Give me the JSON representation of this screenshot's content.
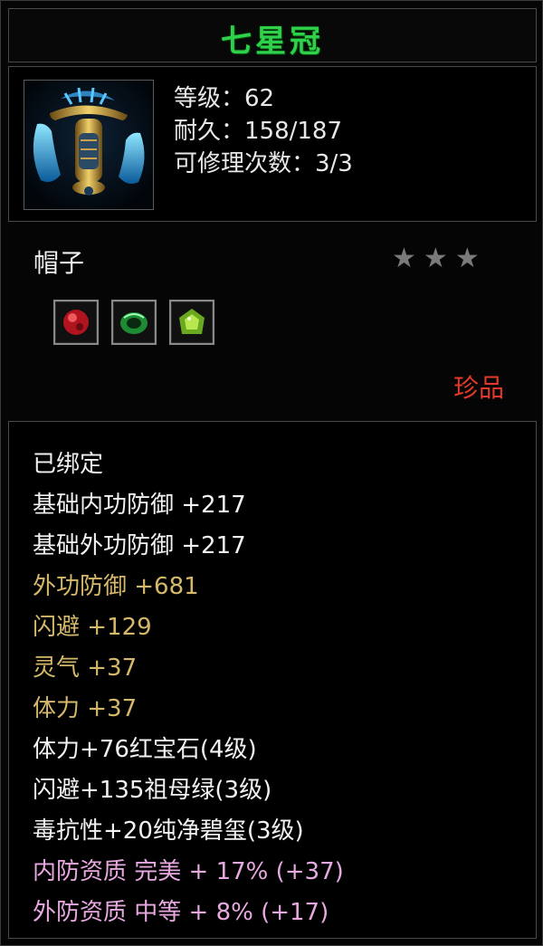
{
  "item": {
    "name": "七星冠",
    "level_line": "等级：62",
    "durability_line": "耐久：158/187",
    "repair_line": "可修理次数：3/3",
    "type": "帽子",
    "rarity": "珍品",
    "stars_count": 3,
    "icon": "crown-icon"
  },
  "gems": [
    {
      "name": "ruby-gem-icon",
      "color": "#c8202a"
    },
    {
      "name": "emerald-gem-icon",
      "color": "#2a9a3a"
    },
    {
      "name": "jade-gem-icon",
      "color": "#7ac02a"
    }
  ],
  "attributes": [
    {
      "text": "已绑定",
      "color": "white"
    },
    {
      "text": "基础内功防御  +217",
      "color": "white"
    },
    {
      "text": "基础外功防御  +217",
      "color": "white"
    },
    {
      "text": "外功防御  +681",
      "color": "gold"
    },
    {
      "text": "闪避  +129",
      "color": "gold"
    },
    {
      "text": "灵气  +37",
      "color": "gold"
    },
    {
      "text": "体力  +37",
      "color": "gold"
    },
    {
      "text": "体力+76红宝石(4级)",
      "color": "white"
    },
    {
      "text": "闪避+135祖母绿(3级)",
      "color": "white"
    },
    {
      "text": "毒抗性+20纯净碧玺(3级)",
      "color": "white"
    },
    {
      "text": "内防资质  完美  + 17% (+37)",
      "color": "pink"
    },
    {
      "text": "外防资质  中等  + 8% (+17)",
      "color": "pink"
    }
  ],
  "colors": {
    "title": "#2fd14b",
    "rarity": "#e23a2a",
    "gold_attr": "#d6b86a",
    "pink_attr": "#e8a8e0",
    "star": "#7a7a7a"
  }
}
